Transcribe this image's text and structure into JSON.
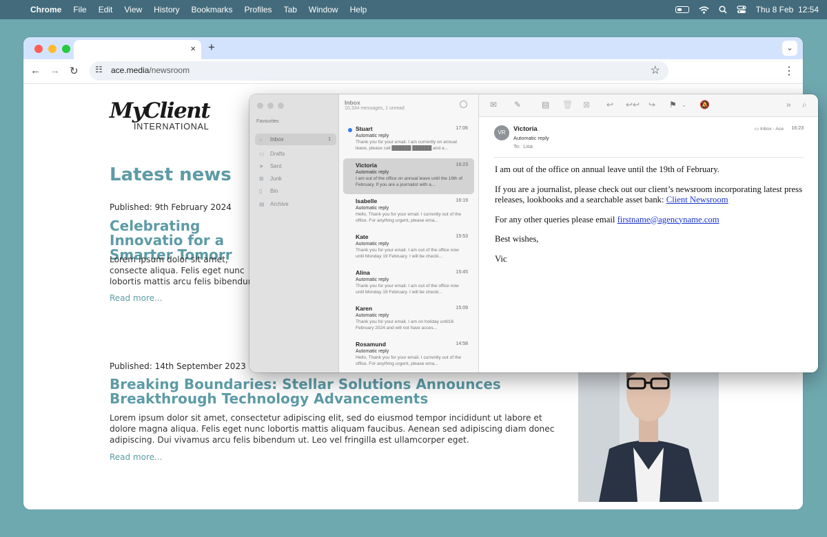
{
  "menubar": {
    "app": "Chrome",
    "items": [
      "File",
      "Edit",
      "View",
      "History",
      "Bookmarks",
      "Profiles",
      "Tab",
      "Window",
      "Help"
    ],
    "datetime": "Thu 8 Feb  12:54",
    "status_icons": [
      "battery-icon",
      "wifi-icon",
      "search-icon",
      "control-center-icon"
    ]
  },
  "browser": {
    "url_domain": "ace.media",
    "url_path": "/newsroom",
    "tab_close": "×",
    "new_tab": "+"
  },
  "page": {
    "logo_script": "MyClient",
    "logo_sub": "INTERNATIONAL",
    "section_title": "Latest news",
    "articles": [
      {
        "published": "Published: 9th February 2024",
        "headline": "Celebrating Innovatio for a Smarter Tomorr",
        "body": "Lorem ipsum dolor sit amet, consecte aliqua. Felis eget nunc lobortis mattis arcu felis bibendum ut. Leo vel fringill",
        "read_more": "Read more..."
      },
      {
        "published": "Published: 14th September 2023",
        "headline": "Breaking Boundaries: Stellar Solutions Announces Breakthrough Technology Advancements",
        "body": "Lorem ipsum dolor sit amet, consectetur adipiscing elit, sed do eiusmod tempor incididunt ut labore et dolore magna aliqua. Felis eget nunc lobortis mattis aliquam faucibus. Aenean sed adipiscing diam donec adipiscing. Dui vivamus arcu felis bibendum ut. Leo vel fringilla est ullamcorper eget.",
        "read_more": "Read more..."
      }
    ]
  },
  "mail": {
    "sidebar": {
      "heading": "Favourites",
      "items": [
        {
          "label": "Inbox",
          "count": "1",
          "icon": "inbox-icon"
        },
        {
          "label": "Drafts",
          "icon": "drafts-icon"
        },
        {
          "label": "Sent",
          "icon": "sent-icon"
        },
        {
          "label": "Junk",
          "icon": "junk-icon"
        },
        {
          "label": "Bin",
          "icon": "bin-icon"
        },
        {
          "label": "Archive",
          "icon": "archive-icon"
        }
      ]
    },
    "list": {
      "title": "Inbox",
      "subtitle": "10,334 messages, 1 unread",
      "messages": [
        {
          "name": "Stuart",
          "time": "17:06",
          "subject": "Automatic reply",
          "preview": "Thank you for your email. I am currently on annual leave, please call ██████ ██████ and a..."
        },
        {
          "name": "Victoria",
          "time": "16:23",
          "subject": "Automatic reply",
          "preview": "I am out of the office on annual leave until the 19th of February. If you are a journalist with a..."
        },
        {
          "name": "Isabelle",
          "time": "16:19",
          "subject": "Automatic reply",
          "preview": "Hello, Thank you for your email. I currently out of the office. For anything urgent, please ema..."
        },
        {
          "name": "Kate",
          "time": "15:53",
          "subject": "Automatic reply",
          "preview": "Thank you for your email. I am out of the office now until Monday 19 February. I will be checki..."
        },
        {
          "name": "Alina",
          "time": "15:45",
          "subject": "Automatic reply",
          "preview": "Thank you for your email. I am out of the office now until Monday 19 February. I will be checki..."
        },
        {
          "name": "Karen",
          "time": "15:09",
          "subject": "Automatic reply",
          "preview": "Thank you for your email. I am on holiday until16 February 2024 and will not have acces..."
        },
        {
          "name": "Rosamund",
          "time": "14:58",
          "subject": "Automatic reply",
          "preview": "Hello, Thank you for your email. I currently out of the office. For anything urgent, please ema..."
        }
      ]
    },
    "reader": {
      "avatar": "VR",
      "from": "Victoria",
      "subject": "Automatic reply",
      "to_label": "To:",
      "to": "Lisa",
      "mailbox": "Inbox - Ace",
      "time": "16:23",
      "p1": "I am out of the office on annual leave until the 19th of February.",
      "p2": "If you are a journalist, please check out our client’s newsroom incorporating latest press releases, lookbooks and a searchable asset bank: ",
      "p2_link": "Client Newsroom",
      "p3": "For any other queries please email ",
      "p3_link": "firstname@agencyname.com",
      "p4": "Best wishes,",
      "p5": "Vic"
    }
  }
}
